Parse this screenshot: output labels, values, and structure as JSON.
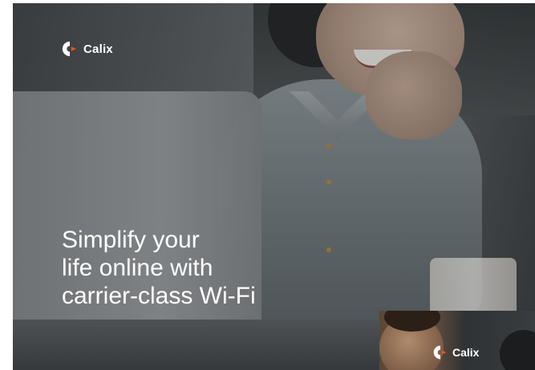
{
  "brand": {
    "name": "Calix",
    "logo_icon": "calix-logo-icon",
    "accent_color": "#e8531f"
  },
  "hero": {
    "headline_lines": [
      "Simplify your",
      "life online with",
      "carrier-class Wi-Fi"
    ]
  },
  "thumbnail": {
    "brand_name": "Calix"
  }
}
